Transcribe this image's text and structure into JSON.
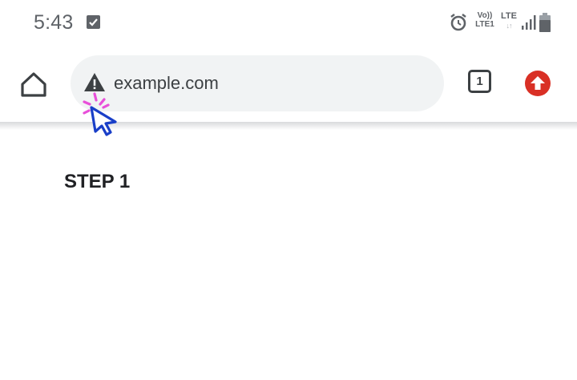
{
  "status_bar": {
    "time": "5:43",
    "volte_top": "Vo))",
    "volte_bottom": "LTE1",
    "lte_top": "LTE",
    "lte_arrows": "↓↑",
    "icons": [
      "check-notification-icon",
      "alarm-icon",
      "signal-icon",
      "battery-icon"
    ]
  },
  "toolbar": {
    "url": "example.com",
    "tab_count": "1",
    "icons": [
      "home-icon",
      "warning-icon",
      "tab-switcher-icon",
      "update-icon"
    ],
    "update_color": "#d93025"
  },
  "annotation": {
    "cursor_color": "#1a3fc8",
    "sparkle_color": "#e84fd9"
  },
  "content": {
    "heading": "STEP 1"
  }
}
